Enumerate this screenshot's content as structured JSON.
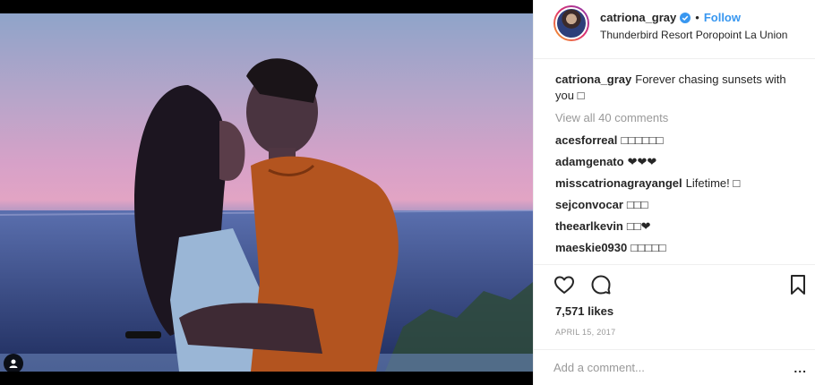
{
  "post": {
    "author": "catriona_gray",
    "follow_label": "Follow",
    "separator": "•",
    "location": "Thunderbird Resort Poropoint La Union"
  },
  "caption": {
    "username": "catriona_gray",
    "text": "Forever chasing sunsets with you □"
  },
  "view_all_comments": "View all 40 comments",
  "comments": [
    {
      "username": "acesforreal",
      "text": "□□□□□□"
    },
    {
      "username": "adamgenato",
      "text": "❤❤❤"
    },
    {
      "username": "misscatrionagrayangel",
      "text": "Lifetime! □"
    },
    {
      "username": "sejconvocar",
      "text": "□□□"
    },
    {
      "username": "theearlkevin",
      "text": "□□❤"
    },
    {
      "username": "maeskie0930",
      "text": "□□□□□"
    }
  ],
  "likes": "7,571 likes",
  "date": "APRIL 15, 2017",
  "add_comment_placeholder": "Add a comment...",
  "more_label": "...",
  "icons": {
    "like": "heart-icon",
    "comment": "comment-icon",
    "save": "bookmark-icon",
    "verified": "verified-badge-icon",
    "tag": "user-tag-icon"
  },
  "colors": {
    "link": "#3897f0",
    "muted": "#999999",
    "text": "#262626",
    "border": "#efefef"
  }
}
